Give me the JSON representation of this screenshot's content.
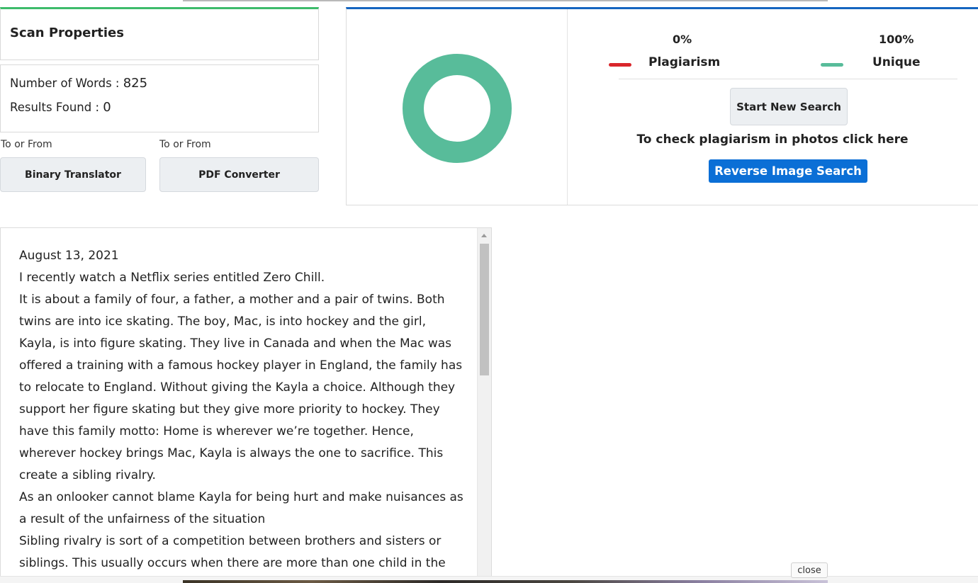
{
  "scan": {
    "title": "Scan Properties",
    "words_label": "Number of Words : ",
    "words_value": "825",
    "results_label": "Results Found : ",
    "results_value": "0"
  },
  "tools": [
    {
      "caption": "To or From",
      "label": "Binary Translator"
    },
    {
      "caption": "To or From",
      "label": "PDF Converter"
    }
  ],
  "result": {
    "plagiarism_percent": "0%",
    "plagiarism_label": "Plagiarism",
    "unique_percent": "100%",
    "unique_label": "Unique",
    "new_search_label": "Start New Search",
    "photo_text": "To check plagiarism in photos click here",
    "reverse_label": "Reverse Image Search",
    "colors": {
      "plagiarism": "#d9262b",
      "unique": "#58bc9a",
      "accent_blue": "#0b6fd6",
      "accent_green": "#3dbb6b"
    }
  },
  "chart_data": {
    "type": "pie",
    "categories": [
      "Plagiarism",
      "Unique"
    ],
    "values": [
      0,
      100
    ]
  },
  "text": {
    "paragraphs": [
      "August 13, 2021",
      "I recently watch a Netflix series entitled Zero Chill.",
      "It is about a family of four, a father, a mother and a pair of twins. Both twins are into ice skating. The boy, Mac, is into hockey and the girl, Kayla, is into figure skating. They live in Canada and when the Mac was offered a training with a famous hockey player in England, the family has to relocate to England. Without giving the Kayla a choice. Although they support her figure skating but they give more priority to hockey. They have this family motto: Home is wherever we’re together. Hence, wherever hockey brings Mac, Kayla is always the one to sacrifice. This create a sibling rivalry.",
      "As an onlooker cannot blame Kayla for being hurt and make nuisances as a result of the unfairness of the situation",
      "Sibling rivalry is sort of a competition between brothers and sisters or siblings. This usually occurs when there are more than one child in the"
    ]
  },
  "close_label": "close"
}
